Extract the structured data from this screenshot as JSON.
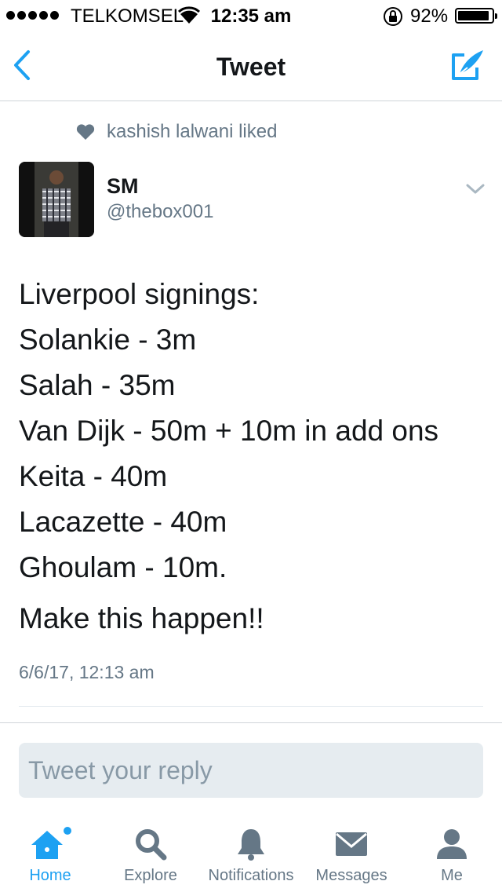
{
  "status_bar": {
    "carrier": "TELKOMSEL",
    "time": "12:35 am",
    "battery": "92%",
    "battery_level": 0.92
  },
  "nav": {
    "title": "Tweet",
    "back_icon": "chevron-left-icon",
    "compose_icon": "compose-icon"
  },
  "tweet": {
    "liked_by": "kashish lalwani liked",
    "author_name": "SM",
    "author_handle": "@thebox001",
    "lines": [
      "Liverpool signings:",
      "Solankie - 3m",
      "Salah - 35m",
      "Van Dijk - 50m + 10m in add ons",
      "Keita - 40m",
      "Lacazette - 40m",
      "Ghoulam - 10m."
    ],
    "closing": "Make this happen!!",
    "timestamp": "6/6/17, 12:13 am"
  },
  "reply": {
    "placeholder": "Tweet your reply"
  },
  "tabs": [
    {
      "label": "Home",
      "icon": "home-icon",
      "active": true
    },
    {
      "label": "Explore",
      "icon": "search-icon",
      "active": false
    },
    {
      "label": "Notifications",
      "icon": "bell-icon",
      "active": false
    },
    {
      "label": "Messages",
      "icon": "envelope-icon",
      "active": false
    },
    {
      "label": "Me",
      "icon": "person-icon",
      "active": false
    }
  ],
  "colors": {
    "accent": "#1da1f2",
    "secondary_text": "#657786",
    "inactive_icon": "#8899a6"
  }
}
